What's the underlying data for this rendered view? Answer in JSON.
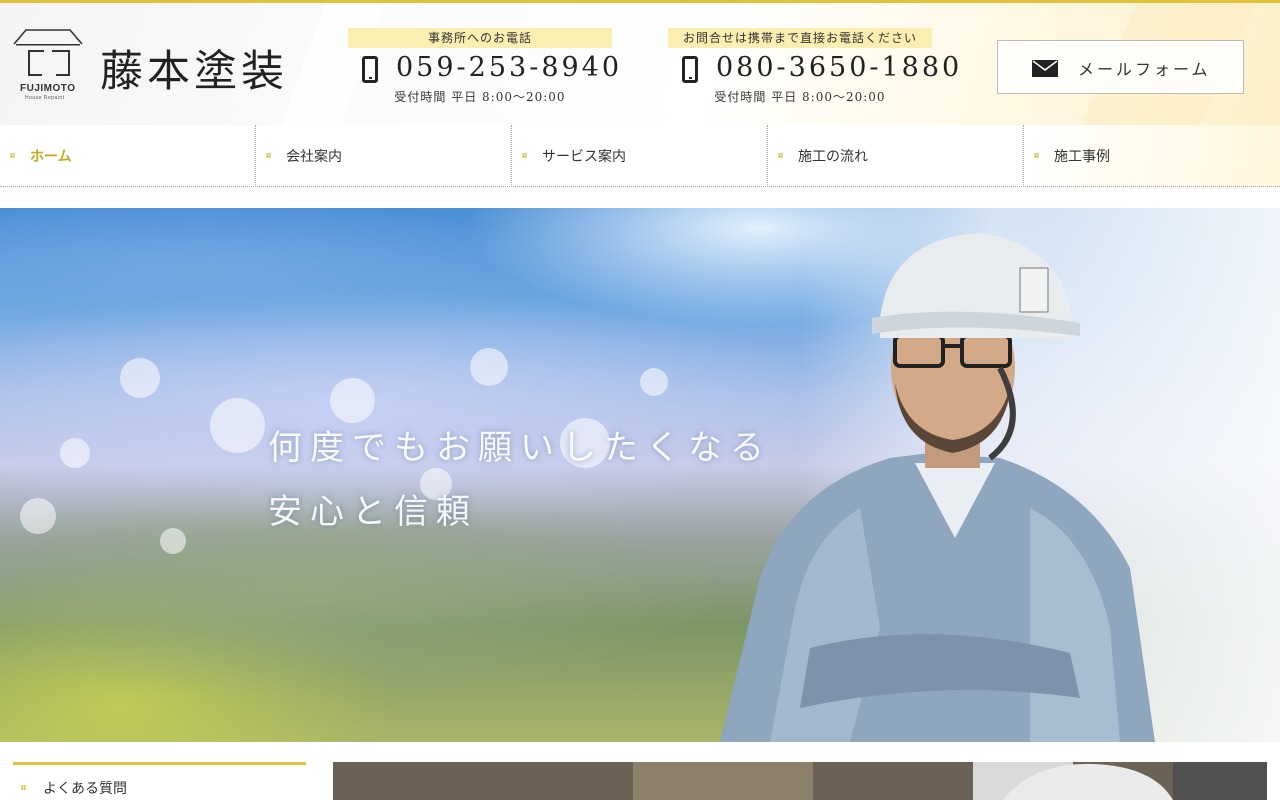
{
  "header": {
    "logo": {
      "en": "FUJIMOTO",
      "sub": "House Repaint"
    },
    "brand": "藤本塗装",
    "office_phone": {
      "tag": "事務所へのお電話",
      "number": "059-253-8940",
      "hours": "受付時間 平日 8:00〜20:00"
    },
    "mobile_phone": {
      "tag": "お問合せは携帯まで直接お電話ください",
      "number": "080-3650-1880",
      "hours": "受付時間 平日 8:00〜20:00"
    },
    "mail_button": {
      "label": "メールフォーム",
      "icon": "envelope-icon"
    }
  },
  "nav": {
    "items": [
      {
        "label": "ホーム",
        "active": true
      },
      {
        "label": "会社案内",
        "active": false
      },
      {
        "label": "サービス案内",
        "active": false
      },
      {
        "label": "施工の流れ",
        "active": false
      },
      {
        "label": "施工事例",
        "active": false
      }
    ]
  },
  "hero": {
    "line1": "何度でもお願いしたくなる",
    "line2": "安心と信頼"
  },
  "sidebar": {
    "faq_label": "よくある質問"
  },
  "colors": {
    "accent": "#e0c33a",
    "tag_bg": "#faeeb0",
    "active_nav": "#c9a71b"
  }
}
